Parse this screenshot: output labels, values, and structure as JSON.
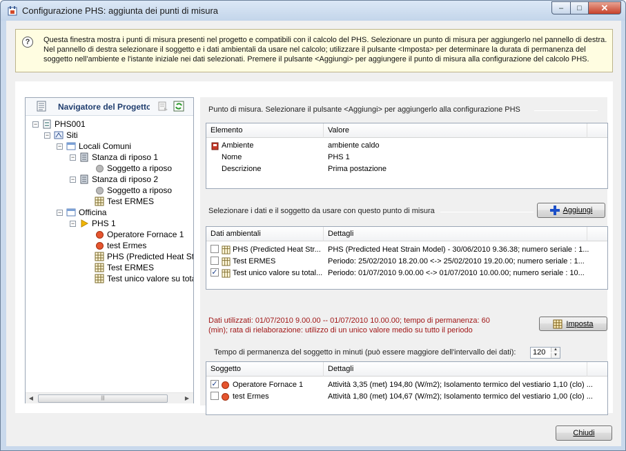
{
  "window": {
    "title": "Configurazione PHS: aggiunta dei punti di misura",
    "controls": {
      "minimize": "–",
      "maximize": "□",
      "close": "✕"
    }
  },
  "info": {
    "line1": "Questa finestra mostra i punti di misura presenti nel progetto e compatibili con il calcolo del PHS. Selezionare un punto di misura per aggiungerlo nel pannello di destra.",
    "line2": "Nel pannello di destra selezionare il soggetto e i dati ambientali da usare nel calcolo; utilizzare il pulsante <Imposta> per determinare la durata di permanenza del",
    "line3": "soggetto nell'ambiente e l'istante iniziale nei dati selezionati. Premere il pulsante <Aggiungi> per aggiungere il punto di misura alla configurazione del calcolo PHS."
  },
  "navigator": {
    "title": "Navigatore del Progetto",
    "tree": [
      {
        "label": "PHS001",
        "icon": "project-icon",
        "expander": "−"
      },
      {
        "label": "Siti",
        "icon": "sites-icon",
        "expander": "−"
      },
      {
        "label": "Locali Comuni",
        "icon": "site-icon",
        "expander": "−"
      },
      {
        "label": "Stanza di riposo 1",
        "icon": "room-icon",
        "expander": "−"
      },
      {
        "label": "Soggetto a riposo",
        "icon": "subject-gray-icon"
      },
      {
        "label": "Stanza di riposo 2",
        "icon": "room-icon",
        "expander": "−"
      },
      {
        "label": "Soggetto a riposo",
        "icon": "subject-gray-icon"
      },
      {
        "label": "Test ERMES",
        "icon": "data-grid-icon"
      },
      {
        "label": "Officina",
        "icon": "site-icon",
        "expander": "−"
      },
      {
        "label": "PHS 1",
        "icon": "measure-point-icon",
        "expander": "−"
      },
      {
        "label": "Operatore Fornace 1",
        "icon": "subject-red-icon"
      },
      {
        "label": "test Ermes",
        "icon": "subject-red-icon"
      },
      {
        "label": "PHS (Predicted Heat Strain Model)",
        "icon": "data-grid-icon"
      },
      {
        "label": "Test ERMES",
        "icon": "data-grid-icon"
      },
      {
        "label": "Test unico valore su totale",
        "icon": "data-grid-icon"
      }
    ],
    "scroll_left": "◀",
    "scroll_right": "▶",
    "scroll_grip": "|||"
  },
  "point": {
    "label": "Punto di misura. Selezionare il pulsante <Aggiungi> per aggiungerlo alla configurazione PHS",
    "headers": [
      "Elemento",
      "Valore"
    ],
    "rows": [
      {
        "element": "Ambiente",
        "value": "ambiente caldo"
      },
      {
        "element": "Nome",
        "value": "PHS 1"
      },
      {
        "element": "Descrizione",
        "value": "Prima postazione"
      }
    ]
  },
  "select": {
    "label": "Selezionare i dati e il soggetto da usare con questo punto di misura",
    "add_button": "Aggiungi"
  },
  "env_data": {
    "headers": [
      "Dati ambientali",
      "Dettagli"
    ],
    "rows": [
      {
        "checked": false,
        "name": "PHS (Predicted Heat Str...",
        "details": "PHS (Predicted Heat Strain Model) - 30/06/2010 9.36.38; numero seriale : 1..."
      },
      {
        "checked": false,
        "name": "Test ERMES",
        "details": "Periodo: 25/02/2010 18.20.00 <-> 25/02/2010 19.20.00; numero seriale : 1..."
      },
      {
        "checked": true,
        "name": "Test unico valore su total...",
        "details": "Periodo: 01/07/2010 9.00.00 <-> 01/07/2010 10.00.00; numero seriale : 10..."
      }
    ]
  },
  "status": {
    "line1": "Dati utilizzati: 01/07/2010 9.00.00 -- 01/07/2010 10.00.00; tempo di permanenza: 60",
    "line2": "(min); rata di rielaborazione: utilizzo di un unico valore medio su tutto il periodo",
    "set_button": "Imposta"
  },
  "permanence": {
    "label": "Tempo di permanenza del soggetto in minuti (può essere maggiore dell'intervallo dei dati):",
    "value": "120",
    "spin_up": "▲",
    "spin_down": "▼"
  },
  "subjects": {
    "headers": [
      "Soggetto",
      "Dettagli"
    ],
    "rows": [
      {
        "checked": true,
        "name": "Operatore Fornace 1",
        "details": "Attività 3,35 (met) 194,80 (W/m2); Isolamento termico del vestiario 1,10 (clo) ..."
      },
      {
        "checked": false,
        "name": "test Ermes",
        "details": "Attività 1,80 (met) 104,67 (W/m2); Isolamento termico del vestiario 1,00 (clo) ..."
      }
    ]
  },
  "footer": {
    "close_button": "Chiudi"
  },
  "colors": {
    "accent": "#1f3d6e",
    "status_text": "#a01616",
    "info_bg": "#fffde1"
  }
}
